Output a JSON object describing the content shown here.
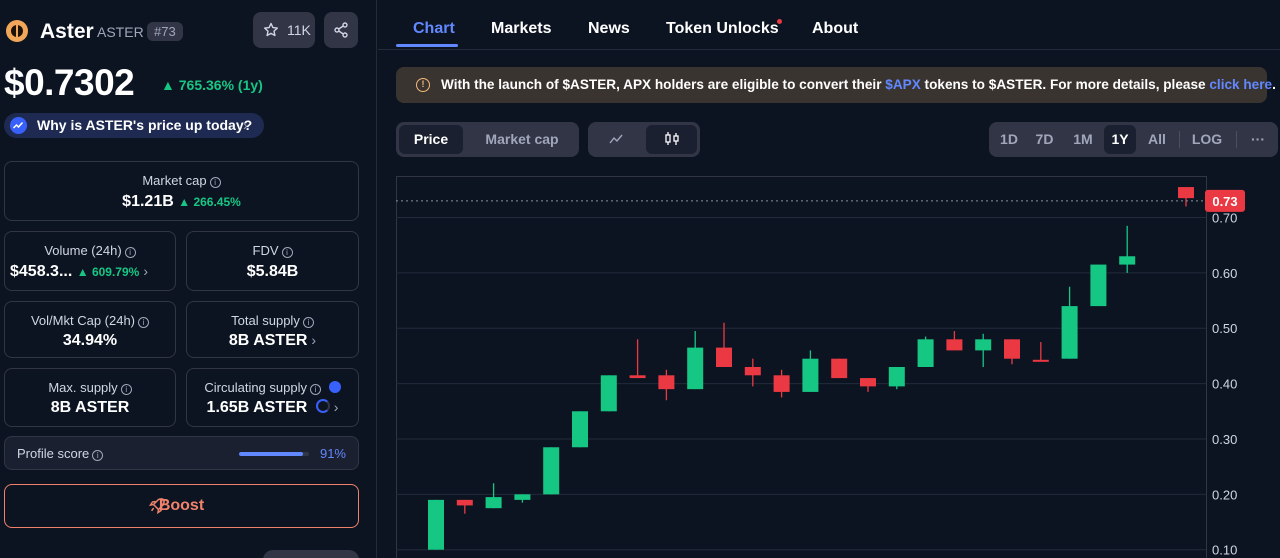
{
  "coin": {
    "name": "Aster",
    "symbol": "ASTER",
    "rank": "#73",
    "watchlist_count": "11K",
    "price": "$0.7302",
    "change": "765.36% (1y)",
    "why_label": "Why is ASTER's price up today?"
  },
  "stats": {
    "market_cap": {
      "label": "Market cap",
      "value": "$1.21B",
      "change": "266.45%"
    },
    "volume": {
      "label": "Volume (24h)",
      "value": "$458.3...",
      "change": "609.79%"
    },
    "fdv": {
      "label": "FDV",
      "value": "$5.84B"
    },
    "vol_mkt": {
      "label": "Vol/Mkt Cap (24h)",
      "value": "34.94%"
    },
    "total_supply": {
      "label": "Total supply",
      "value": "8B ASTER"
    },
    "max_supply": {
      "label": "Max. supply",
      "value": "8B ASTER"
    },
    "circulating_supply": {
      "label": "Circulating supply",
      "value": "1.65B ASTER"
    }
  },
  "profile": {
    "label": "Profile score",
    "value": "91%",
    "fraction": 0.91
  },
  "boost_label": "Boost",
  "tabs": [
    "Chart",
    "Markets",
    "News",
    "Token Unlocks",
    "About"
  ],
  "banner": {
    "text1": "With the launch of $ASTER, APX holders are eligible to convert their ",
    "link1": "$APX",
    "text2": " tokens to $ASTER. For more details, please ",
    "link2": "click here",
    "text3": "."
  },
  "chart_toggle": [
    "Price",
    "Market cap"
  ],
  "ranges": [
    "1D",
    "7D",
    "1M",
    "1Y",
    "All",
    "LOG"
  ],
  "more_label": "···",
  "colors": {
    "up": "#16c784",
    "down": "#ea3943",
    "accent": "#6188ff"
  },
  "chart_data": {
    "type": "candlestick",
    "y_ticks": [
      "0.70",
      "0.60",
      "0.50",
      "0.40",
      "0.30",
      "0.20",
      "0.10"
    ],
    "ylim": [
      0.085,
      0.775
    ],
    "current_price_label": "0.73",
    "current_price": 0.73,
    "candles": [
      {
        "o": 0.1,
        "c": 0.19,
        "h": 0.19,
        "l": 0.1
      },
      {
        "o": 0.19,
        "c": 0.18,
        "h": 0.19,
        "l": 0.165
      },
      {
        "o": 0.175,
        "c": 0.195,
        "h": 0.22,
        "l": 0.175
      },
      {
        "o": 0.19,
        "c": 0.2,
        "h": 0.2,
        "l": 0.185
      },
      {
        "o": 0.2,
        "c": 0.285,
        "h": 0.285,
        "l": 0.2
      },
      {
        "o": 0.285,
        "c": 0.35,
        "h": 0.35,
        "l": 0.285
      },
      {
        "o": 0.35,
        "c": 0.415,
        "h": 0.415,
        "l": 0.35
      },
      {
        "o": 0.415,
        "c": 0.41,
        "h": 0.48,
        "l": 0.41
      },
      {
        "o": 0.415,
        "c": 0.39,
        "h": 0.425,
        "l": 0.37
      },
      {
        "o": 0.39,
        "c": 0.465,
        "h": 0.495,
        "l": 0.39
      },
      {
        "o": 0.465,
        "c": 0.43,
        "h": 0.51,
        "l": 0.43
      },
      {
        "o": 0.43,
        "c": 0.415,
        "h": 0.445,
        "l": 0.395
      },
      {
        "o": 0.415,
        "c": 0.385,
        "h": 0.425,
        "l": 0.375
      },
      {
        "o": 0.385,
        "c": 0.445,
        "h": 0.46,
        "l": 0.385
      },
      {
        "o": 0.445,
        "c": 0.41,
        "h": 0.445,
        "l": 0.41
      },
      {
        "o": 0.41,
        "c": 0.395,
        "h": 0.41,
        "l": 0.385
      },
      {
        "o": 0.395,
        "c": 0.43,
        "h": 0.43,
        "l": 0.39
      },
      {
        "o": 0.43,
        "c": 0.48,
        "h": 0.485,
        "l": 0.43
      },
      {
        "o": 0.48,
        "c": 0.46,
        "h": 0.495,
        "l": 0.46
      },
      {
        "o": 0.46,
        "c": 0.48,
        "h": 0.49,
        "l": 0.43
      },
      {
        "o": 0.48,
        "c": 0.445,
        "h": 0.48,
        "l": 0.435
      },
      {
        "o": 0.443,
        "c": 0.44,
        "h": 0.475,
        "l": 0.44
      },
      {
        "o": 0.445,
        "c": 0.54,
        "h": 0.575,
        "l": 0.445
      },
      {
        "o": 0.54,
        "c": 0.615,
        "h": 0.615,
        "l": 0.54
      },
      {
        "o": 0.615,
        "c": 0.63,
        "h": 0.685,
        "l": 0.6
      },
      {
        "o": 0.755,
        "c": 0.735,
        "h": 0.755,
        "l": 0.72
      }
    ]
  }
}
